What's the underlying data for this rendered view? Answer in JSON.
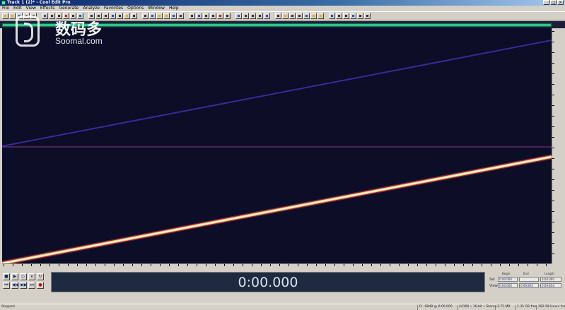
{
  "window": {
    "title": "Track 1 (2)* - Cool Edit Pro"
  },
  "menu": [
    "File",
    "Edit",
    "View",
    "Effects",
    "Generate",
    "Analyze",
    "Favorites",
    "Options",
    "Window",
    "Help"
  ],
  "watermark": {
    "cn": "数码多",
    "en": "Soomal.com"
  },
  "transport": {
    "row1": [
      "■",
      "▶",
      "▷",
      "⏸",
      "↻"
    ],
    "row2": [
      "⏮",
      "◀◀",
      "▶▶",
      "⏭",
      "●"
    ]
  },
  "time_display": "0:00.000",
  "selection": {
    "headers": [
      "Begin",
      "End",
      "Length"
    ],
    "rows": [
      {
        "label": "Sel",
        "begin": "0:00.000",
        "end": "",
        "length": "0:00.000"
      },
      {
        "label": "View",
        "begin": "0:00.000",
        "end": "0:09.854",
        "length": "0:09.854"
      }
    ]
  },
  "status": {
    "left": "Stopped",
    "fields": [
      "R: -98dB @ 0:00.000",
      "44100 • 16-bit • Stereo",
      "3.75 MB",
      "1.35 GB free",
      "282.58 Hours free"
    ]
  },
  "spectrum": {
    "top_channel_color": "#3a2a9a",
    "bottom_channel_color": "#fff4d8",
    "background": "#0c0d26"
  }
}
